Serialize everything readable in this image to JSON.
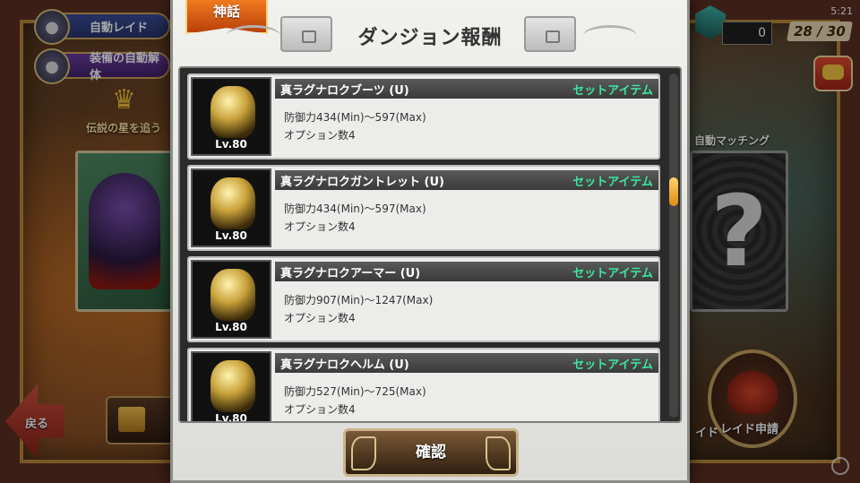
{
  "hud": {
    "auto_raid_label": "自動レイド",
    "auto_dismantle_label": "装備の自動解体",
    "legend_text": "伝説の星を追う",
    "back_label": "戻る",
    "score": "0",
    "clock": "5:21",
    "stamina": "28 / 30",
    "auto_match_label": "自動マッチング",
    "raid_apply_label": "レイド申請",
    "ido_label": "イド"
  },
  "modal": {
    "tab_label": "神話",
    "title": "ダンジョン報酬",
    "confirm_label": "確認",
    "scroll_fraction": 0.3,
    "items": [
      {
        "name": "真ラグナロクブーツ (U)",
        "set": "セットアイテム",
        "stat": "防御力434(Min)〜597(Max)",
        "options": "オプション数4",
        "level": "Lv.80"
      },
      {
        "name": "真ラグナロクガントレット (U)",
        "set": "セットアイテム",
        "stat": "防御力434(Min)〜597(Max)",
        "options": "オプション数4",
        "level": "Lv.80"
      },
      {
        "name": "真ラグナロクアーマー (U)",
        "set": "セットアイテム",
        "stat": "防御力907(Min)〜1247(Max)",
        "options": "オプション数4",
        "level": "Lv.80"
      },
      {
        "name": "真ラグナロクヘルム (U)",
        "set": "セットアイテム",
        "stat": "防御力527(Min)〜725(Max)",
        "options": "オプション数4",
        "level": "Lv.80"
      }
    ]
  },
  "colors": {
    "set_text": "#3ce6a0",
    "tab_orange": "#f07a1f",
    "scroll_thumb": "#f0a42a"
  }
}
